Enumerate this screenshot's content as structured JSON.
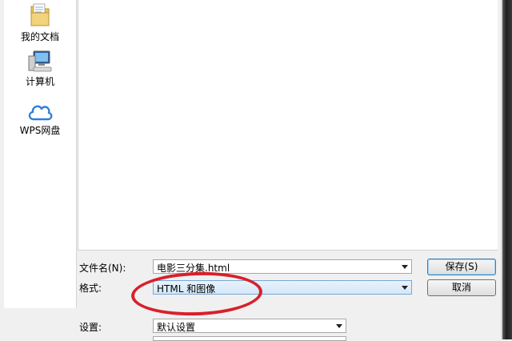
{
  "sidebar": {
    "items": [
      {
        "label": "我的文档",
        "icon": "folder-icon"
      },
      {
        "label": "计算机",
        "icon": "computer-icon"
      },
      {
        "label": "WPS网盘",
        "icon": "cloud-icon"
      }
    ]
  },
  "form": {
    "filename_label": "文件名(N):",
    "filename_value": "电影三分集.html",
    "format_label": "格式:",
    "format_value": "HTML 和图像",
    "settings_label": "设置:",
    "settings_value": "默认设置"
  },
  "buttons": {
    "save": "保存(S)",
    "cancel": "取消"
  },
  "colors": {
    "annotation": "#d8202a",
    "accent": "#3c7fb1"
  }
}
